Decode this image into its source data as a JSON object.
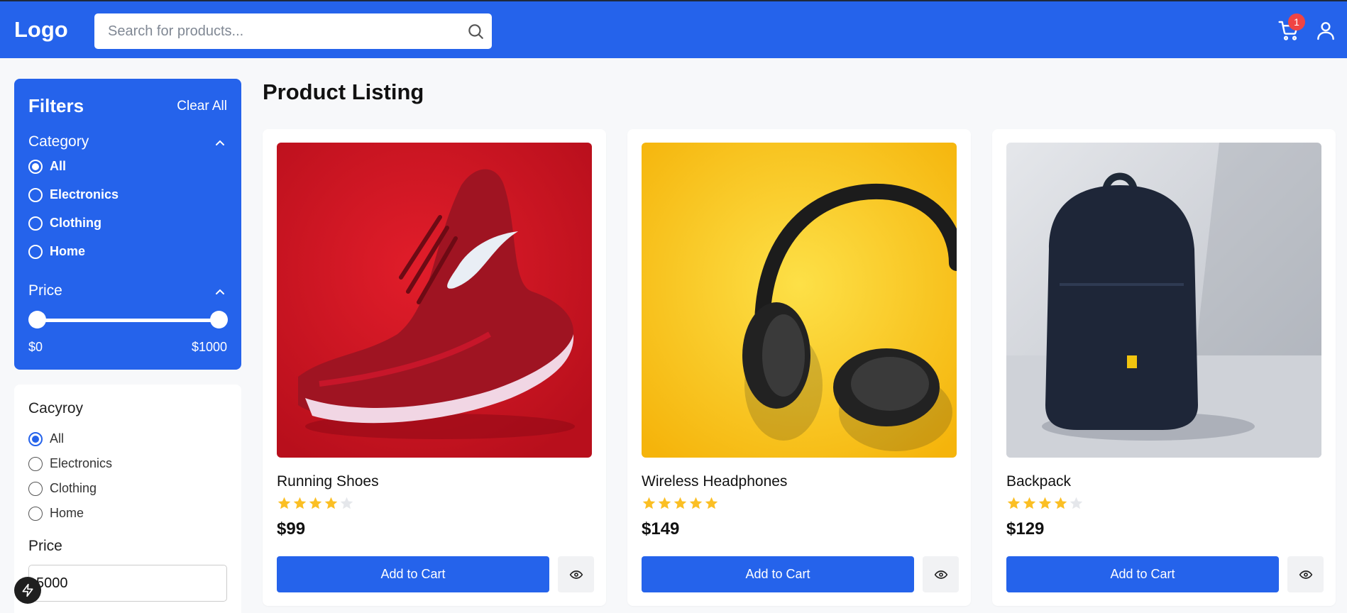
{
  "header": {
    "logo": "Logo",
    "search_placeholder": "Search for products...",
    "cart_count": "1",
    "brand_color": "#2563eb"
  },
  "filters": {
    "title": "Filters",
    "clear_label": "Clear All",
    "category_label": "Category",
    "categories": [
      "All",
      "Electronics",
      "Clothing",
      "Home"
    ],
    "selected_category": "All",
    "price_label": "Price",
    "price_min": "$0",
    "price_max": "$1000"
  },
  "filters2": {
    "category_label": "Cacyroy",
    "categories": [
      "All",
      "Electronics",
      "Clothing",
      "Home"
    ],
    "selected_category": "All",
    "price_label": "Price",
    "price_value": "5000"
  },
  "main": {
    "title": "Product Listing",
    "add_to_cart_label": "Add to Cart",
    "products": [
      {
        "name": "Running Shoes",
        "rating": 4,
        "price": "$99",
        "image": "red running shoe on red background"
      },
      {
        "name": "Wireless Headphones",
        "rating": 5,
        "price": "$149",
        "image": "black headphones on yellow background"
      },
      {
        "name": "Backpack",
        "rating": 4,
        "price": "$129",
        "image": "navy backpack on grey floor"
      }
    ]
  },
  "icons": {
    "search": "search-icon",
    "cart": "shopping-cart-icon",
    "user": "user-icon",
    "chevron": "chevron-up-icon",
    "eye": "eye-icon",
    "star": "star-icon",
    "bolt": "lightning-bolt-icon"
  },
  "colors": {
    "star": "#fbbf24",
    "star_empty": "#e5e7eb",
    "badge": "#ef4444"
  }
}
